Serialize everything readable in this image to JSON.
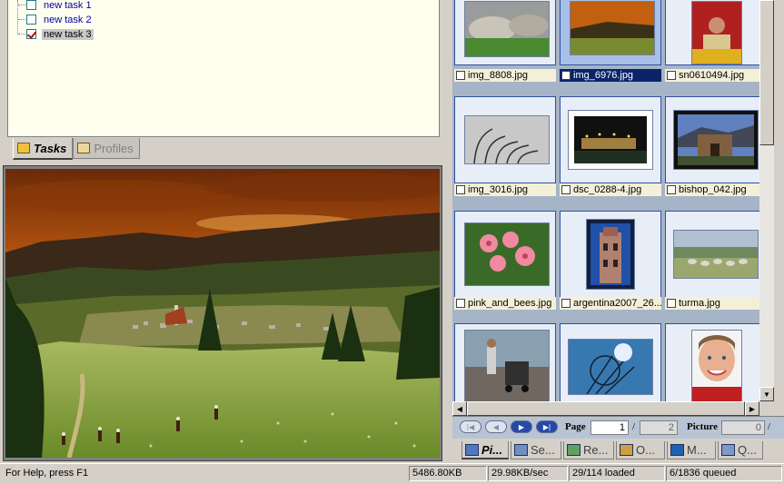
{
  "tasks": {
    "items": [
      {
        "label": "new task 1",
        "checked": false
      },
      {
        "label": "new task 2",
        "checked": false
      },
      {
        "label": "new task 3",
        "checked": true
      }
    ]
  },
  "left_tabs": [
    {
      "label": "Tasks",
      "icon": "folder-open-icon",
      "active": true
    },
    {
      "label": "Profiles",
      "icon": "profiles-icon",
      "active": false
    }
  ],
  "thumbnails": [
    {
      "name": "img_8808.jpg",
      "selected": false
    },
    {
      "name": "img_6976.jpg",
      "selected": true
    },
    {
      "name": "sn0610494.jpg",
      "selected": false
    },
    {
      "name": "img_3016.jpg",
      "selected": false
    },
    {
      "name": "dsc_0288-4.jpg",
      "selected": false
    },
    {
      "name": "bishop_042.jpg",
      "selected": false
    },
    {
      "name": "pink_and_bees.jpg",
      "selected": false
    },
    {
      "name": "argentina2007_26...",
      "selected": false
    },
    {
      "name": "turma.jpg",
      "selected": false
    },
    {
      "name": "",
      "selected": false
    },
    {
      "name": "",
      "selected": false
    },
    {
      "name": "",
      "selected": false
    }
  ],
  "pager": {
    "page_label": "Page",
    "page_current": "1",
    "separator": "/",
    "page_total": "2",
    "picture_label": "Picture",
    "picture_value": "0",
    "picture_separator": "/"
  },
  "bottom_tabs": [
    {
      "label": "Pi...",
      "active": true
    },
    {
      "label": "Se...",
      "active": false
    },
    {
      "label": "Re...",
      "active": false
    },
    {
      "label": "O...",
      "active": false
    },
    {
      "label": "M...",
      "active": false
    },
    {
      "label": "Q...",
      "active": false
    }
  ],
  "status": {
    "help": "For Help, press F1",
    "size": "5486.80KB",
    "rate": "29.98KB/sec",
    "loaded": "29/114 loaded",
    "queued": "6/1836 queued"
  },
  "colors": {
    "selection": "#0a246a",
    "task_text": "#0000aa",
    "check_mark": "#c00000"
  }
}
